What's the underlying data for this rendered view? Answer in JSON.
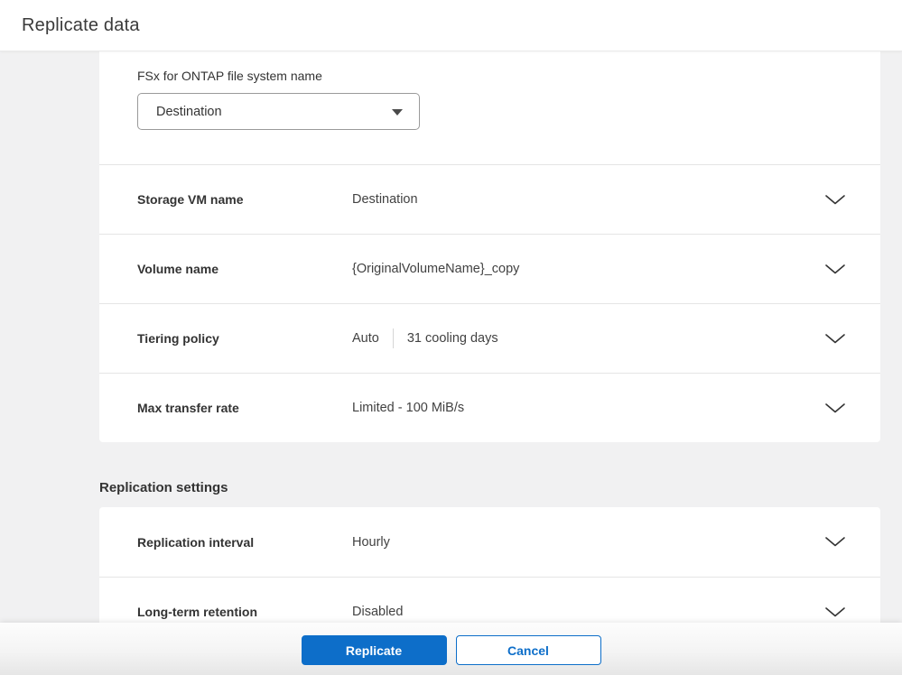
{
  "header": {
    "title": "Replicate data"
  },
  "form": {
    "file_system": {
      "label": "FSx for ONTAP file system name",
      "selected": "Destination"
    },
    "rows": [
      {
        "label": "Storage VM name",
        "value": "Destination"
      },
      {
        "label": "Volume name",
        "value": "{OriginalVolumeName}_copy"
      },
      {
        "label": "Tiering policy",
        "value": "Auto",
        "value2": "31 cooling days"
      },
      {
        "label": "Max transfer rate",
        "value": "Limited - 100 MiB/s"
      }
    ],
    "replication_section": {
      "heading": "Replication settings",
      "rows": [
        {
          "label": "Replication interval",
          "value": "Hourly"
        },
        {
          "label": "Long-term retention",
          "value": "Disabled"
        }
      ]
    }
  },
  "footer": {
    "replicate_label": "Replicate",
    "cancel_label": "Cancel"
  },
  "icons": {
    "row_expander": "chevron-down-icon",
    "select_caret": "caret-down-icon"
  },
  "colors": {
    "primary_blue": "#0d6ec9",
    "page_background": "#f1f1f2",
    "card_background": "#ffffff",
    "divider": "#e5e5e5",
    "text_dark": "#333333"
  }
}
